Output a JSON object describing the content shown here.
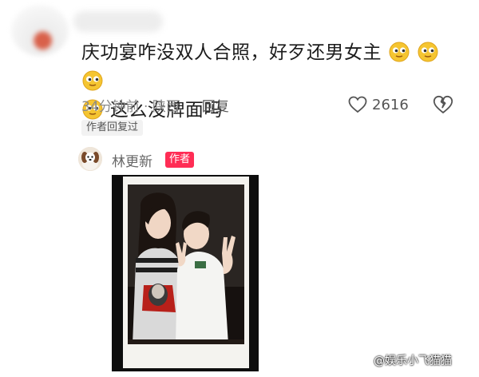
{
  "comment": {
    "line1": "庆功宴咋没双人合照，好歹还男女主",
    "line2": "这么没牌面吗",
    "time_location": "34分钟前 · 陕西",
    "reply_label": "回复",
    "likes": "2616",
    "author_replied_tag": "作者回复过"
  },
  "reply": {
    "username": "林更新",
    "author_badge": "作者"
  },
  "watermark": "@娱乐小飞猫猫",
  "colors": {
    "accent_badge": "#ff2d55",
    "meta_gray": "#8a8a8a",
    "text_dark": "#1c1c1c",
    "emoji_yellow": "#f5c531"
  },
  "icons": [
    "heart-icon",
    "heart-broken-icon",
    "emoji-icon",
    "avatar"
  ]
}
